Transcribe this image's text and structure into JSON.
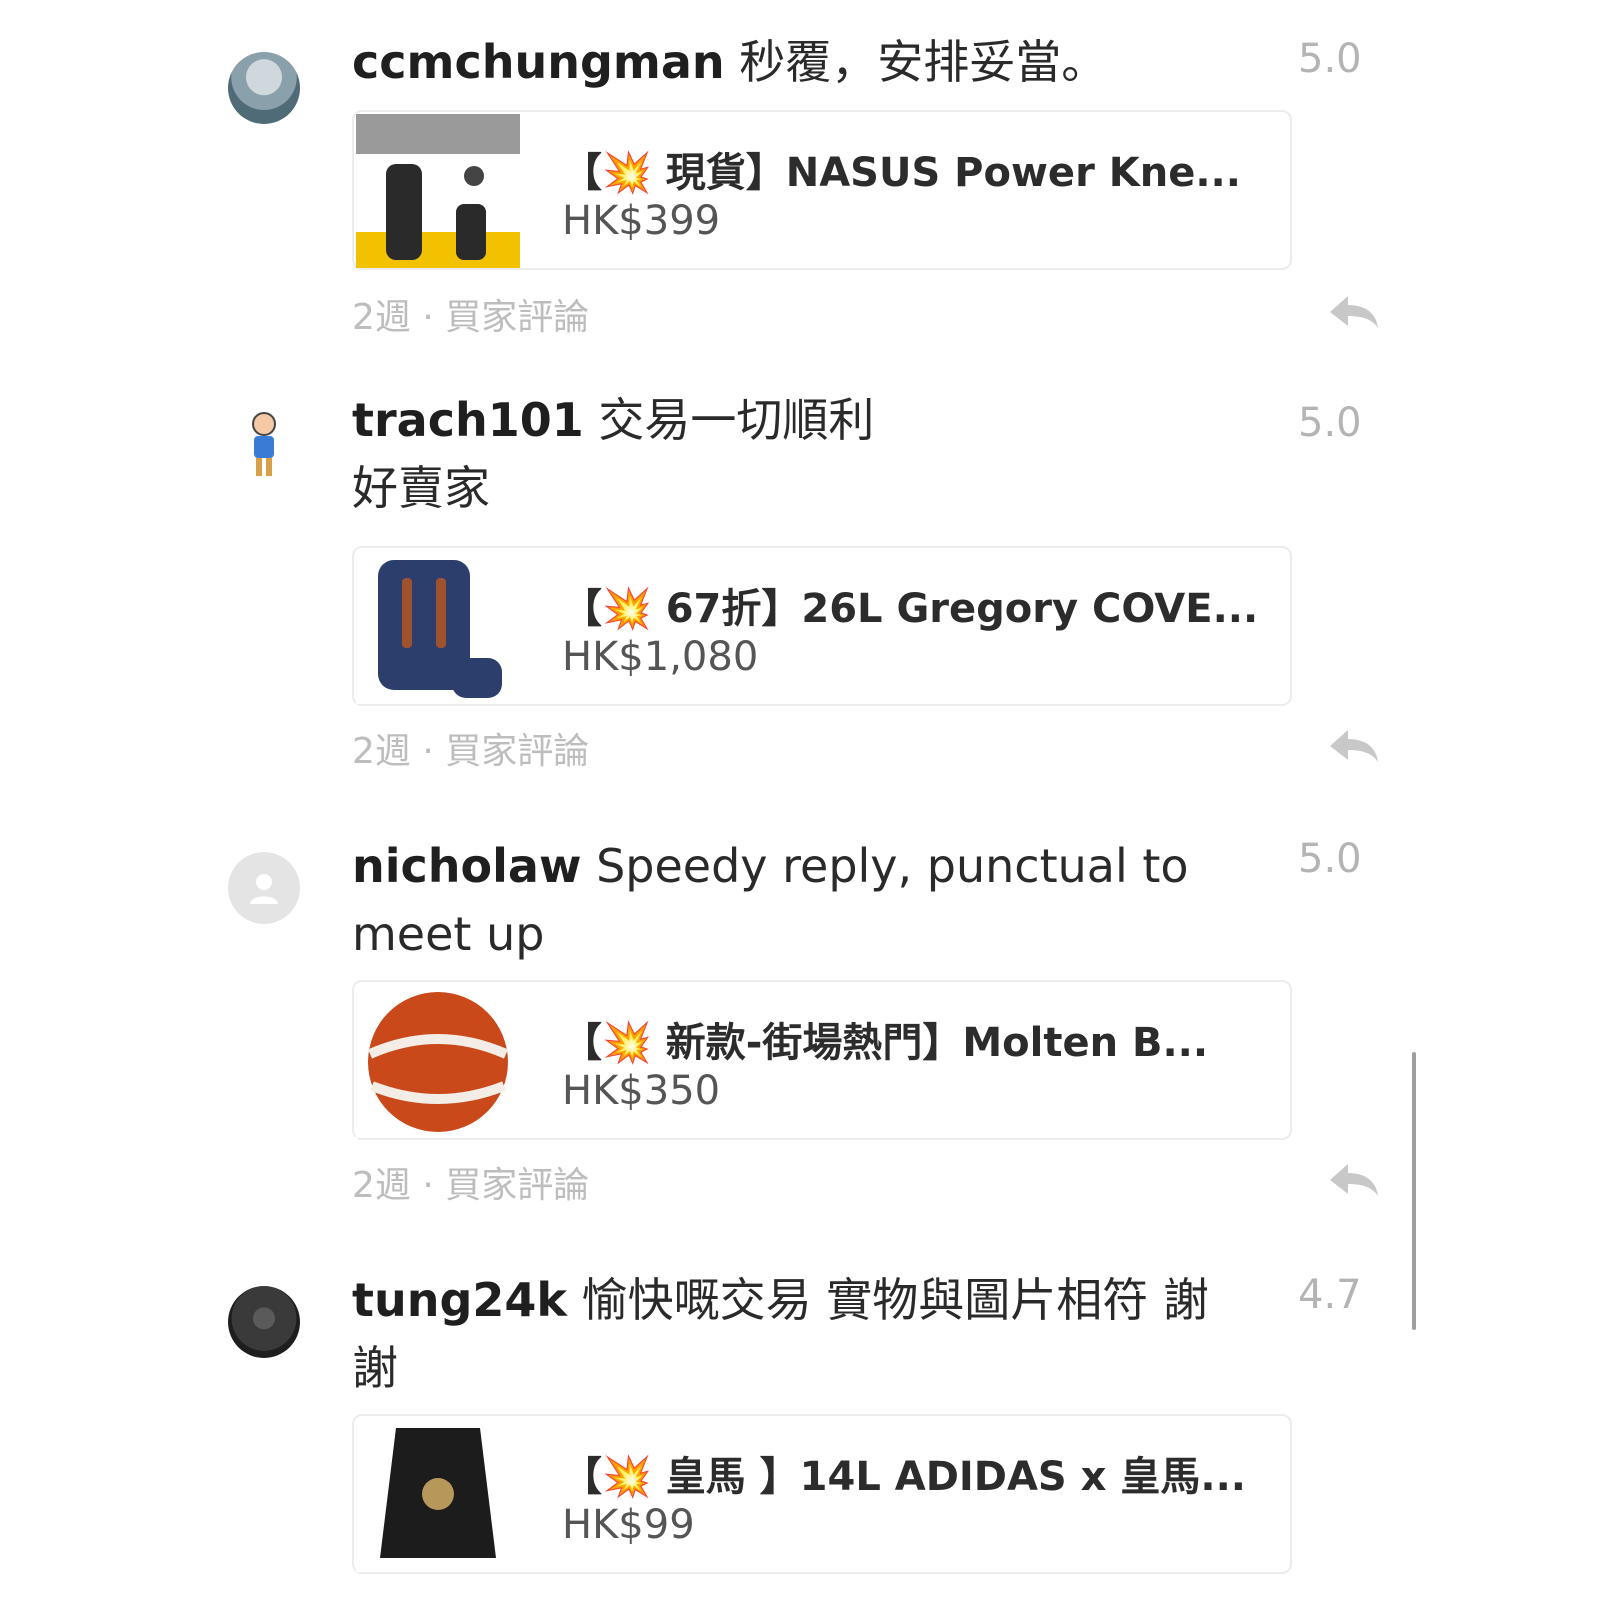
{
  "reviews": [
    {
      "username": "ccmchungman",
      "comment": "秒覆，安排妥當。",
      "rating": "5.0",
      "product": {
        "title": "【💥 現貨】NASUS Power Kne...",
        "price": "HK$399"
      },
      "meta": "2週 · 買家評論",
      "avatar_icon": "user-photo"
    },
    {
      "username": "trach101",
      "comment": "交易一切順利",
      "comment_line2": "好賣家",
      "rating": "5.0",
      "product": {
        "title": "【💥 67折】26L Gregory COVE...",
        "price": "HK$1,080"
      },
      "meta": "2週 · 買家評論",
      "avatar_icon": "cartoon-avatar"
    },
    {
      "username": "nicholaw",
      "comment": "Speedy reply, punctual to",
      "comment_line2": "meet up",
      "rating": "5.0",
      "product": {
        "title": "【💥 新款-街場熱門】Molten B...",
        "price": "HK$350"
      },
      "meta": "2週 · 買家評論",
      "avatar_icon": "default-user-icon"
    },
    {
      "username": "tung24k",
      "comment": "愉快嘅交易 實物與圖片相符 謝",
      "comment_line2": "謝",
      "rating": "4.7",
      "product": {
        "title": "【💥 皇馬 】14L ADIDAS x 皇馬...",
        "price": "HK$99"
      },
      "avatar_icon": "user-photo"
    }
  ],
  "colors": {
    "text_primary": "#222222",
    "text_muted": "#b4b4b4",
    "card_border": "#ececec"
  }
}
